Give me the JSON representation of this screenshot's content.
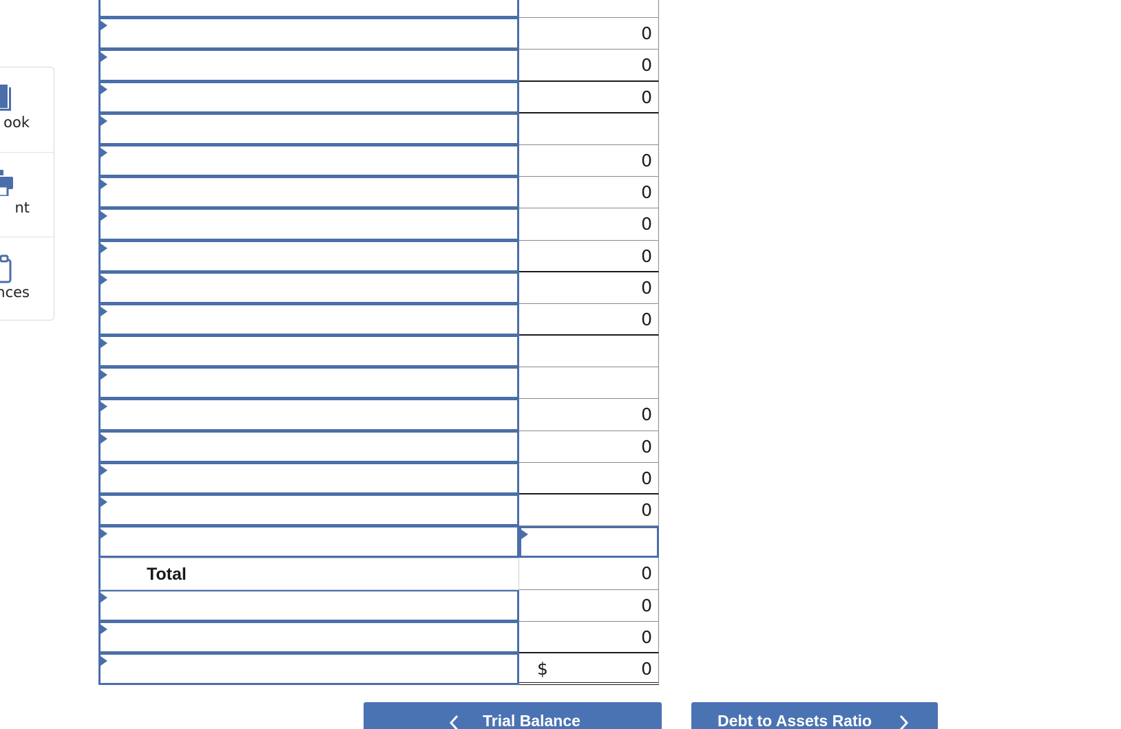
{
  "side_panel": {
    "items": [
      {
        "label": "ook",
        "icon": "book-icon"
      },
      {
        "label": "nt",
        "icon": "print-icon"
      },
      {
        "label": "ences",
        "icon": "references-icon"
      }
    ]
  },
  "sheet": {
    "total_label": "Total",
    "currency_symbol": "$",
    "rows": [
      {
        "value": ""
      },
      {
        "value": "0"
      },
      {
        "value": "0"
      },
      {
        "value": "0"
      },
      {
        "value": ""
      },
      {
        "value": "0"
      },
      {
        "value": "0"
      },
      {
        "value": "0"
      },
      {
        "value": "0"
      },
      {
        "value": "0"
      },
      {
        "value": "0"
      },
      {
        "value": ""
      },
      {
        "value": ""
      },
      {
        "value": "0"
      },
      {
        "value": "0"
      },
      {
        "value": "0"
      },
      {
        "value": "0"
      },
      {
        "value": ""
      },
      {
        "value": "0"
      },
      {
        "value": "0"
      },
      {
        "value": "0"
      },
      {
        "value": "0"
      }
    ]
  },
  "nav": {
    "prev_label": "Trial Balance",
    "next_label": "Debt to Assets Ratio"
  },
  "colors": {
    "accent": "#4a6ea9",
    "button": "#4a73b4"
  }
}
